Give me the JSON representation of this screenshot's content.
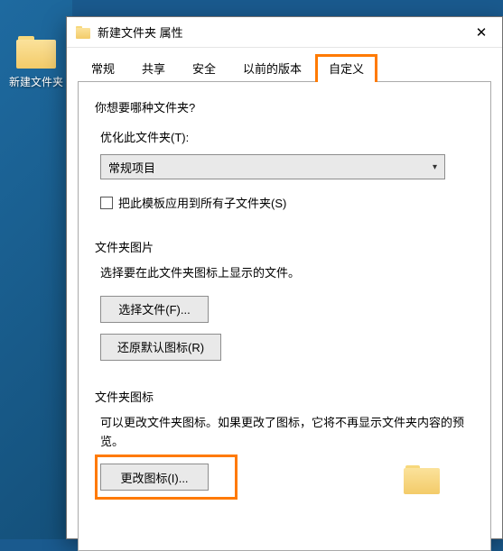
{
  "desktop": {
    "icon_label": "新建文件夹"
  },
  "dialog": {
    "title": "新建文件夹 属性",
    "tabs": {
      "general": "常规",
      "sharing": "共享",
      "security": "安全",
      "previous": "以前的版本",
      "customize": "自定义"
    },
    "customize_panel": {
      "question": "你想要哪种文件夹?",
      "optimize_label": "优化此文件夹(T):",
      "optimize_value": "常规项目",
      "apply_subfolders": "把此模板应用到所有子文件夹(S)",
      "picture_group_title": "文件夹图片",
      "picture_desc": "选择要在此文件夹图标上显示的文件。",
      "choose_file_btn": "选择文件(F)...",
      "restore_default_btn": "还原默认图标(R)",
      "icon_group_title": "文件夹图标",
      "icon_desc": "可以更改文件夹图标。如果更改了图标，它将不再显示文件夹内容的预览。",
      "change_icon_btn": "更改图标(I)..."
    }
  }
}
